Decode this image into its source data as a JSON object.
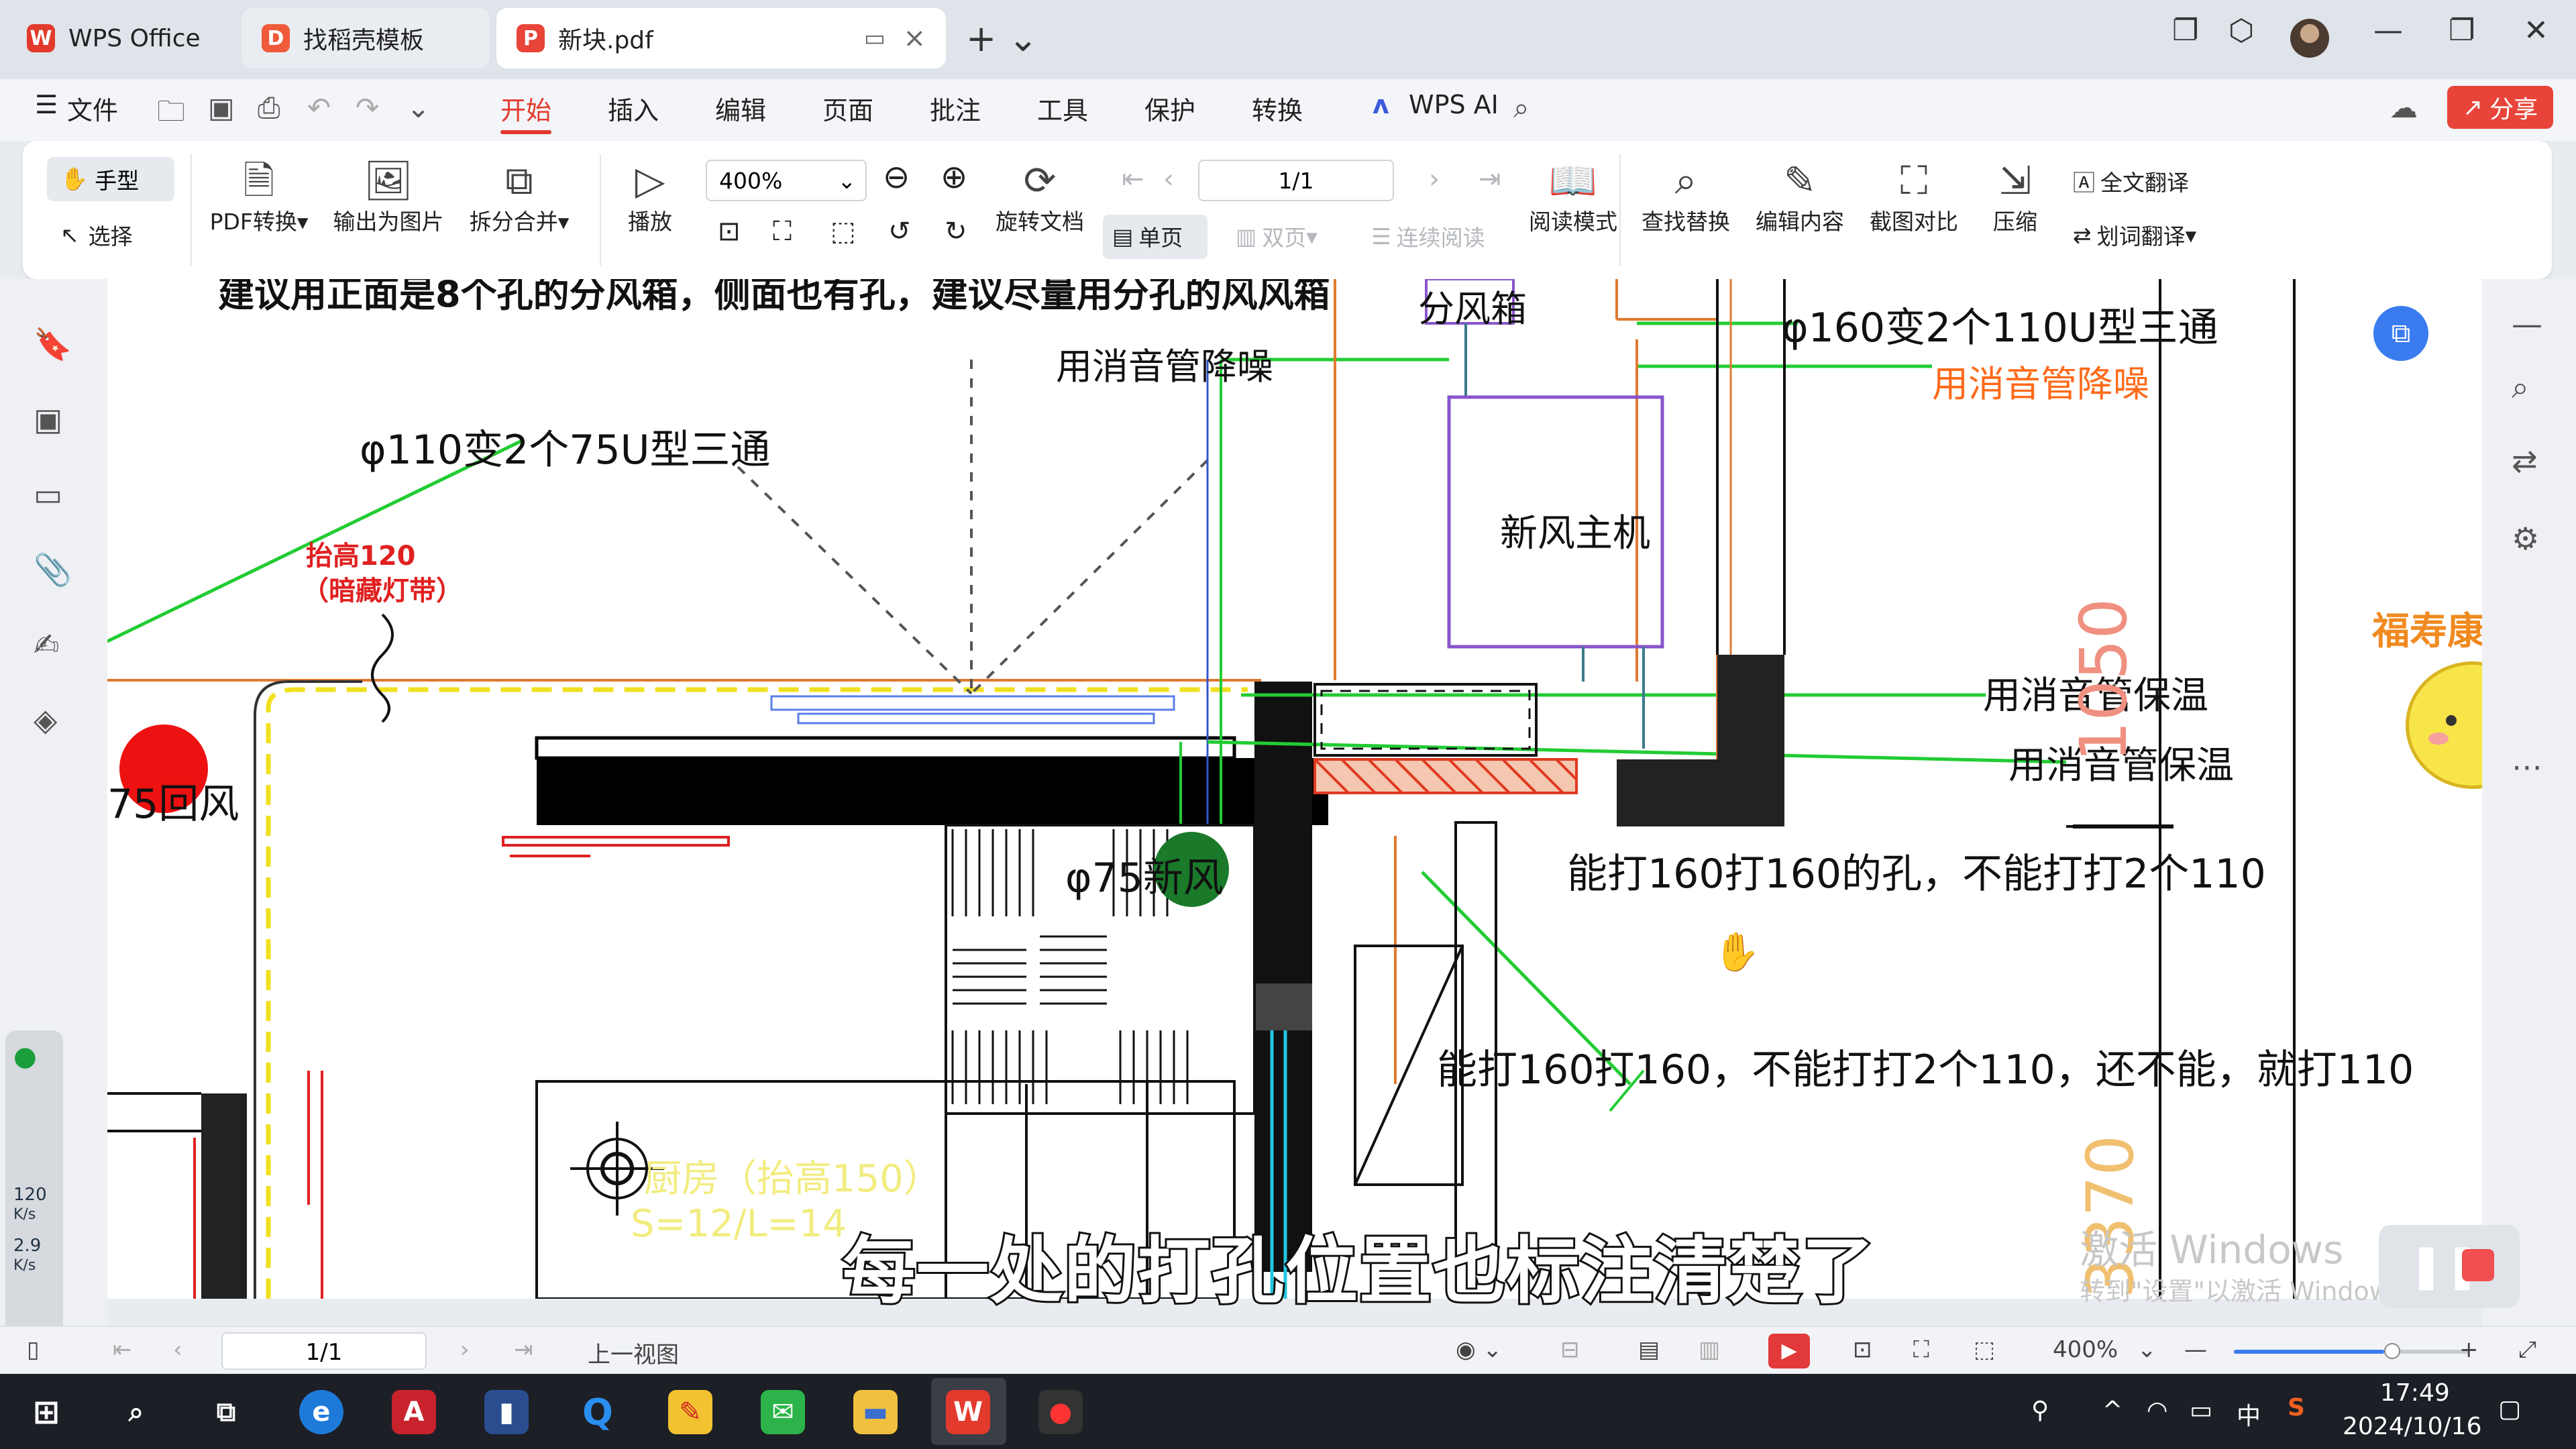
{
  "tabs": {
    "wps_office": "WPS Office",
    "template": "找稻壳模板",
    "document": "新块.pdf"
  },
  "menu": {
    "file": "文件",
    "items": [
      "开始",
      "插入",
      "编辑",
      "页面",
      "批注",
      "工具",
      "保护",
      "转换"
    ],
    "wps_ai": "WPS AI",
    "share": "分享"
  },
  "ribbon": {
    "hand": "手型",
    "select": "选择",
    "pdf_convert": "PDF转换",
    "export_image": "输出为图片",
    "split_merge": "拆分合并",
    "play": "播放",
    "zoom": "400%",
    "rotate_doc": "旋转文档",
    "single_page": "单页",
    "double_page": "双页",
    "continuous": "连续阅读",
    "page": "1/1",
    "read_mode": "阅读模式",
    "find_replace": "查找替换",
    "edit_content": "编辑内容",
    "screenshot_compare": "截图对比",
    "compress": "压缩",
    "full_translate": "全文翻译",
    "word_translate": "划词翻译"
  },
  "drawing": {
    "top_cut": "建议用正面是8个孔的分风箱，侧面也有孔，建议尽量用分孔的风风箱",
    "fan_box": "分风箱",
    "silencer_1": "用消音管降噪",
    "reducer_110": "φ110变2个75U型三通",
    "reducer_160": "φ160变2个110U型三通",
    "silencer_2": "用消音管降噪",
    "lift_120": "抬高120",
    "hidden_light": "（暗藏灯带）",
    "unit": "新风主机",
    "insulation_1": "用消音管保温",
    "insulation_2": "用消音管保温",
    "return_air": "75回风",
    "fresh_air": "φ75新风",
    "hole_note_1": "能打160打160的孔，不能打打2个110",
    "hole_note_2": "能打160打160，不能打打2个110，还不能，就打110",
    "kitchen": "厨房（抬高150）",
    "kitchen_size": "S=12/L=14",
    "dim_1": "1050",
    "dim_2": "3370",
    "subtitle": "每一处的打孔位置也标注清楚了",
    "watermark_1": "激活 Windows",
    "watermark_2": "转到\"设置\"以激活 Windows。",
    "sticker": "福寿康柠"
  },
  "network": {
    "up": "120",
    "up_unit": "K/s",
    "down": "2.9",
    "down_unit": "K/s"
  },
  "statusbar": {
    "page": "1/1",
    "prev_view": "上一视图",
    "zoom": "400%",
    "zoom_fraction": 0.64
  },
  "taskbar": {
    "time": "17:49",
    "date": "2024/10/16",
    "ime": "中"
  }
}
